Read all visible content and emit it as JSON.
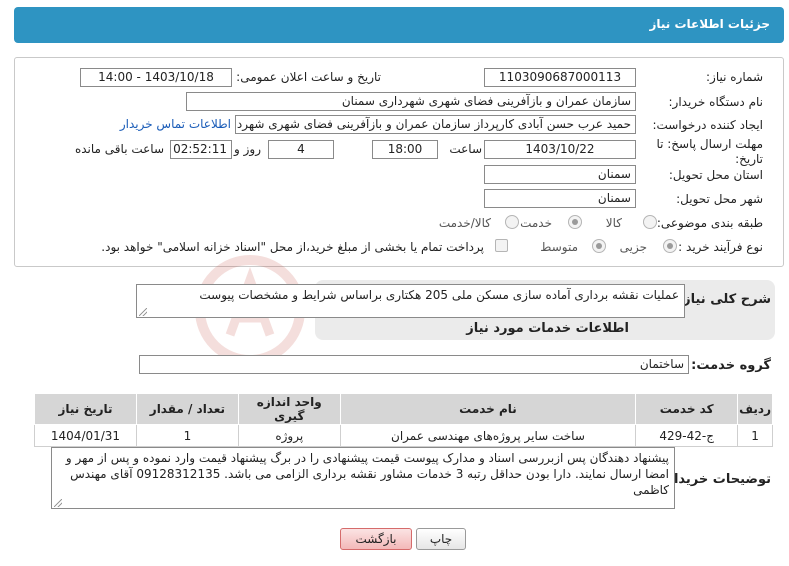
{
  "header": {
    "title": "جزئیات اطلاعات نیاز"
  },
  "form": {
    "need_number": {
      "label": "شماره نیاز:",
      "value": "1103090687000113"
    },
    "announce_datetime": {
      "label": "تاریخ و ساعت اعلان عمومی:",
      "value": "1403/10/18 - 14:00"
    },
    "buyer_org": {
      "label": "نام دستگاه خریدار:",
      "value": "سازمان عمران و بازآفرینی فضای شهری شهرداری سمنان"
    },
    "requester": {
      "label": "ایجاد کننده درخواست:",
      "value": "حمید عرب حسن آبادی کارپرداز سازمان عمران و بازآفرینی فضای شهری شهردار",
      "contact_link": "اطلاعات تماس خریدار"
    },
    "deadline": {
      "label_line1": "مهلت ارسال پاسخ: تا",
      "label_line2": "تاریخ:",
      "date": "1403/10/22",
      "time_label": "ساعت",
      "time": "18:00",
      "days": "4",
      "days_label": "روز و",
      "remaining_time": "02:52:11",
      "remaining_label": "ساعت باقی مانده"
    },
    "province": {
      "label": "استان محل تحویل:",
      "value": "سمنان"
    },
    "city": {
      "label": "شهر محل تحویل:",
      "value": "سمنان"
    },
    "category": {
      "label": "طبقه بندی موضوعی:",
      "options": [
        "کالا",
        "خدمت",
        "کالا/خدمت"
      ],
      "selected": "خدمت"
    },
    "purchase_process": {
      "label": "نوع فرآیند خرید :",
      "options": [
        "جزیی",
        "متوسط"
      ],
      "selected": "جزیی",
      "treasury_note": "پرداخت تمام یا بخشی از مبلغ خرید،از محل \"اسناد خزانه اسلامی\" خواهد بود."
    }
  },
  "summary": {
    "label": "شرح کلی نیاز:",
    "value": "عملیات نقشه برداری آماده سازی مسکن ملی 205 هکتاری براساس شرایط و مشخصات پیوست"
  },
  "services": {
    "section_title": "اطلاعات خدمات مورد نیاز",
    "group_label": "گروه خدمت:",
    "group_value": "ساختمان",
    "columns": [
      "ردیف",
      "کد خدمت",
      "نام خدمت",
      "واحد اندازه گیری",
      "تعداد / مقدار",
      "تاریخ نیاز"
    ],
    "rows": [
      {
        "row": "1",
        "code": "ج-42-429",
        "name": "ساخت سایر پروژه‌های مهندسی عمران",
        "unit": "پروژه",
        "qty": "1",
        "date": "1404/01/31"
      }
    ]
  },
  "buyer_notes": {
    "label": "توضیحات خریدار:",
    "value": "پیشنهاد دهندگان پس ازبررسی اسناد و مدارک پیوست قیمت پیشنهادی را در برگ پیشنهاد قیمت وارد نموده و پس از مهر و امضا ارسال نمایند. دارا بودن حداقل رتبه 3 خدمات مشاور نقشه برداری الزامی می باشد. 09128312135 آقای مهندس کاظمی"
  },
  "buttons": {
    "print": "چاپ",
    "back": "بازگشت"
  },
  "colors": {
    "header": "#2e94c2",
    "link": "#1a5cb8",
    "back_button": "#f3b9b9"
  }
}
